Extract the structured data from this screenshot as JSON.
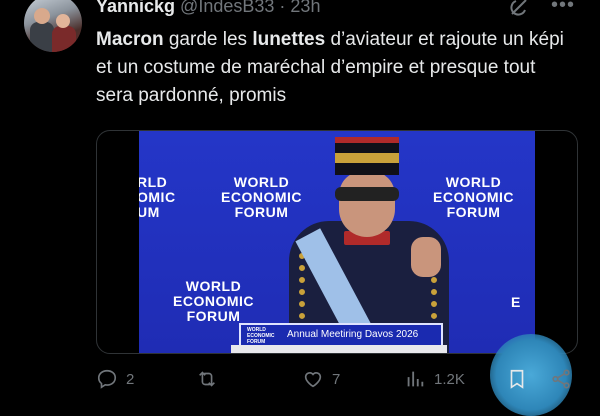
{
  "author": {
    "name": "Yannickg",
    "handle": "@IndesB33",
    "separator": "·",
    "time": "23h"
  },
  "tweet": {
    "segments": [
      {
        "text": "Macron",
        "bold": true
      },
      {
        "text": " garde les ",
        "bold": false
      },
      {
        "text": "lunettes",
        "bold": true
      },
      {
        "text": " d’aviateur et rajoute un képi et un costume de maréchal d’empire et presque tout sera pardonné, promis",
        "bold": false
      }
    ]
  },
  "media": {
    "wef_lines": [
      "WORLD",
      "ECONOMIC",
      "FORUM"
    ],
    "wef_left_partial": [
      "RLD",
      "OMIC",
      "UM"
    ],
    "wef_right_partial": "E",
    "lectern_logo": [
      "WORLD",
      "ECONOMIC",
      "FORUM"
    ],
    "lectern_text": "Annual Meetiring Davos 2026"
  },
  "actions": {
    "reply_count": "2",
    "retweet_count": "",
    "like_count": "7",
    "views_count": "1.2K"
  },
  "colors": {
    "accent": "#1d9bf0",
    "muted": "#71767b",
    "stage_blue": "#2436c8"
  },
  "icons": [
    "grok-icon",
    "more-icon",
    "reply-icon",
    "retweet-icon",
    "like-icon",
    "views-icon",
    "bookmark-icon",
    "share-icon"
  ]
}
